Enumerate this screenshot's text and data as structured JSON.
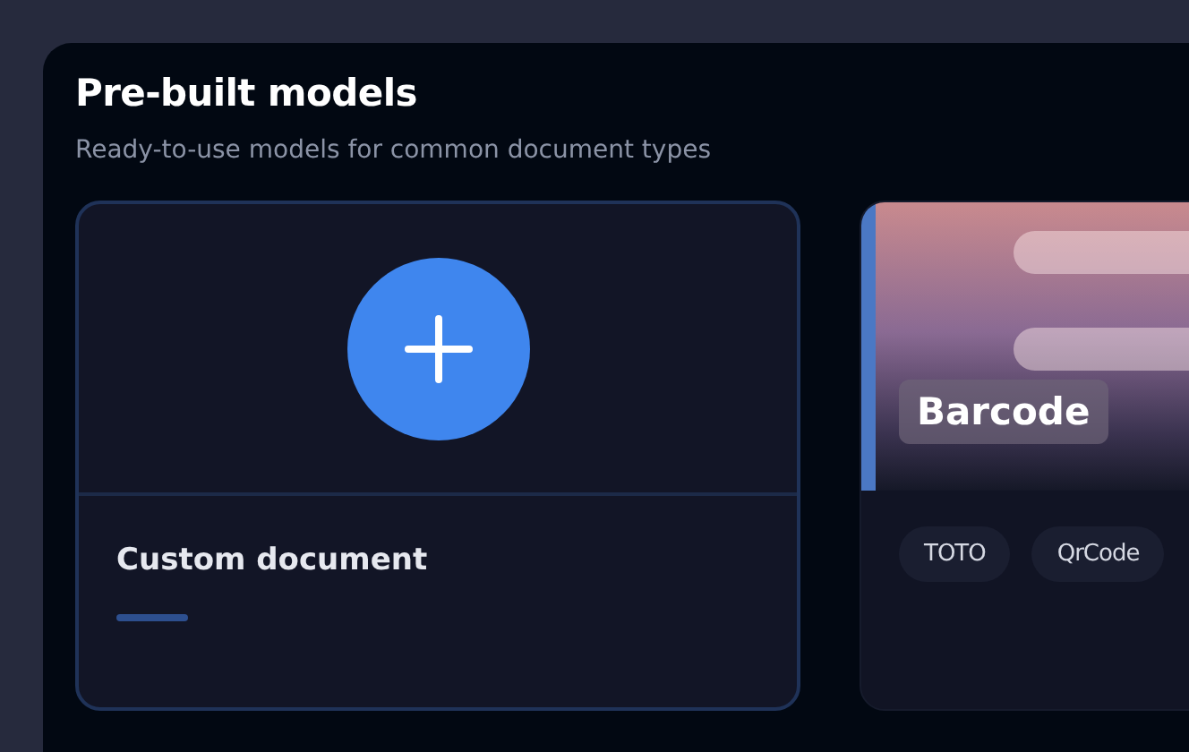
{
  "section": {
    "title": "Pre-built models",
    "subtitle": "Ready-to-use models for common document types"
  },
  "cards": [
    {
      "kind": "custom",
      "title": "Custom document"
    },
    {
      "kind": "model",
      "title": "Barcode",
      "tags": [
        "TOTO",
        "QrCode"
      ]
    }
  ]
}
